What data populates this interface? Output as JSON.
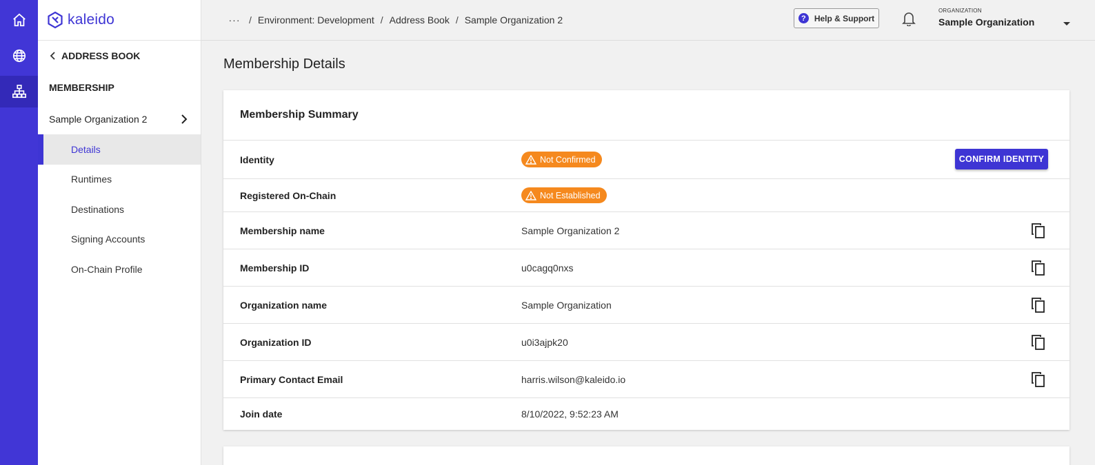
{
  "brand": {
    "name": "kaleido"
  },
  "rail": {
    "items": [
      "home-icon",
      "globe-icon",
      "network-icon"
    ]
  },
  "sidebar": {
    "back_label": "ADDRESS BOOK",
    "section_title": "MEMBERSHIP",
    "org_item": "Sample Organization 2",
    "nav": [
      "Details",
      "Runtimes",
      "Destinations",
      "Signing Accounts",
      "On-Chain Profile"
    ],
    "active_nav": "Details"
  },
  "header": {
    "more_label": "···",
    "breadcrumbs": [
      "Environment: Development",
      "Address Book",
      "Sample Organization 2"
    ],
    "help_label": "Help & Support",
    "org_label": "ORGANIZATION",
    "org_value": "Sample Organization"
  },
  "main": {
    "page_title": "Membership Details",
    "card_title": "Membership Summary",
    "identity": {
      "label": "Identity",
      "status": "Not Confirmed",
      "action": "CONFIRM IDENTITY"
    },
    "registered": {
      "label": "Registered On-Chain",
      "status": "Not Established"
    },
    "fields": [
      {
        "label": "Membership name",
        "value": "Sample Organization 2",
        "copyable": true
      },
      {
        "label": "Membership ID",
        "value": "u0cagq0nxs",
        "copyable": true
      },
      {
        "label": "Organization name",
        "value": "Sample Organization",
        "copyable": true
      },
      {
        "label": "Organization ID",
        "value": "u0i3ajpk20",
        "copyable": true
      },
      {
        "label": "Primary Contact Email",
        "value": "harris.wilson@kaleido.io",
        "copyable": true
      },
      {
        "label": "Join date",
        "value": "8/10/2022, 9:52:23 AM",
        "copyable": false
      }
    ]
  },
  "colors": {
    "brand": "#4136d6",
    "warning": "#f5891e"
  }
}
